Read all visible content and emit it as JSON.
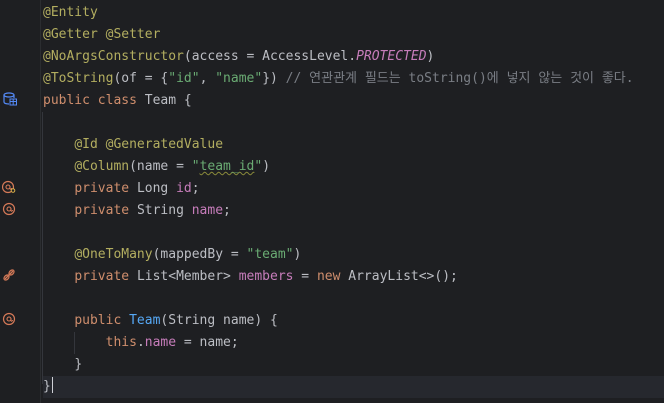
{
  "lines": [
    {
      "parts": [
        "@Entity"
      ]
    },
    {
      "parts": [
        "@Getter @Setter"
      ]
    },
    {
      "parts": [
        "@NoArgsConstructor",
        "(access = AccessLevel.",
        "PROTECTED",
        ")"
      ]
    },
    {
      "parts": [
        "@ToString",
        "(of = {",
        "\"id\"",
        ", ",
        "\"name\"",
        "}) ",
        "// 연관관계 필드는 toString()에 넣지 않는 것이 좋다."
      ]
    },
    {
      "parts": [
        "public class ",
        "Team {"
      ]
    },
    {
      "parts": []
    },
    {
      "parts": [
        "    ",
        "@Id @GeneratedValue"
      ]
    },
    {
      "parts": [
        "    ",
        "@Column",
        "(name = ",
        "\"",
        "team_id",
        "\"",
        ")"
      ]
    },
    {
      "parts": [
        "    ",
        "private ",
        "Long ",
        "id",
        ";"
      ]
    },
    {
      "parts": [
        "    ",
        "private ",
        "String ",
        "name",
        ";"
      ]
    },
    {
      "parts": []
    },
    {
      "parts": [
        "    ",
        "@OneToMany",
        "(mappedBy = ",
        "\"team\"",
        ")"
      ]
    },
    {
      "parts": [
        "    ",
        "private ",
        "List<Member> ",
        "members",
        " = ",
        "new ",
        "ArrayList<>();"
      ]
    },
    {
      "parts": []
    },
    {
      "parts": [
        "    ",
        "public ",
        "Team",
        "(String name) {"
      ]
    },
    {
      "parts": [
        "        ",
        "this",
        ".",
        "name",
        " = name;"
      ]
    },
    {
      "parts": [
        "    ",
        "}"
      ]
    },
    {
      "parts": [
        "}"
      ]
    }
  ],
  "colors": {
    "background": "#1e1f22",
    "annotation": "#b3ae60",
    "keyword": "#cf8e6d",
    "string": "#6aab73",
    "field": "#c77dbb",
    "comment": "#7a7e85",
    "method": "#56a8f5",
    "text": "#bcbec4"
  },
  "gutter_icons": [
    {
      "line": 4,
      "icon": "database-table-icon"
    },
    {
      "line": 8,
      "icon": "at-key-icon"
    },
    {
      "line": 9,
      "icon": "at-icon"
    },
    {
      "line": 12,
      "icon": "relation-link-icon"
    },
    {
      "line": 14,
      "icon": "at-icon"
    }
  ]
}
